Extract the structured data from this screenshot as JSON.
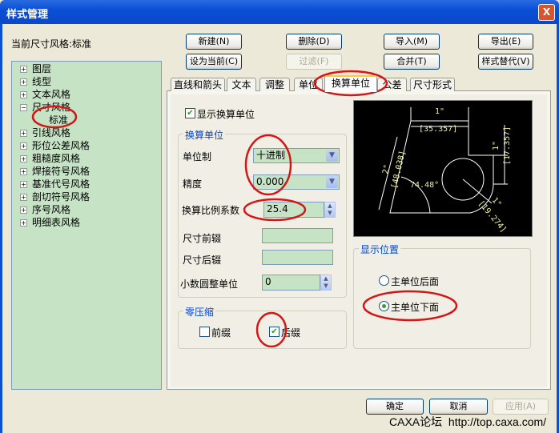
{
  "window": {
    "title": "样式管理",
    "close": "X"
  },
  "current_style": "当前尺寸风格:标准",
  "toolbar": {
    "new": "新建(N)",
    "delete": "删除(D)",
    "import": "导入(M)",
    "export": "导出(E)",
    "set_current": "设为当前(C)",
    "filter": "过滤(F)",
    "merge": "合并(T)",
    "replace": "样式替代(V)"
  },
  "tree": {
    "items": [
      {
        "label": "图层",
        "expanded": false
      },
      {
        "label": "线型",
        "expanded": false
      },
      {
        "label": "文本风格",
        "expanded": false
      },
      {
        "label": "尺寸风格",
        "expanded": true,
        "children": [
          "标准"
        ]
      },
      {
        "label": "引线风格",
        "expanded": false
      },
      {
        "label": "形位公差风格",
        "expanded": false
      },
      {
        "label": "粗糙度风格",
        "expanded": false
      },
      {
        "label": "焊接符号风格",
        "expanded": false
      },
      {
        "label": "基准代号风格",
        "expanded": false
      },
      {
        "label": "剖切符号风格",
        "expanded": false
      },
      {
        "label": "序号风格",
        "expanded": false
      },
      {
        "label": "明细表风格",
        "expanded": false
      }
    ]
  },
  "tabs": [
    "直线和箭头",
    "文本",
    "调整",
    "单位",
    "换算单位",
    "公差",
    "尺寸形式"
  ],
  "active_tab": "换算单位",
  "panel": {
    "show_alt_units": {
      "label": "显示换算单位",
      "checked": true
    },
    "alt_group": "换算单位",
    "unit_format": {
      "label": "单位制",
      "value": "十进制"
    },
    "precision": {
      "label": "精度",
      "value": "0.000"
    },
    "multiplier": {
      "label": "换算比例系数",
      "value": "25.4"
    },
    "prefix": {
      "label": "尺寸前辍",
      "value": ""
    },
    "suffix": {
      "label": "尺寸后辍",
      "value": ""
    },
    "round_off": {
      "label": "小数圆整单位",
      "value": "0"
    },
    "zero_group": "零压缩",
    "leading": {
      "label": "前缀",
      "checked": false
    },
    "trailing": {
      "label": "后缀",
      "checked": true
    },
    "placement_group": "显示位置",
    "after_primary": {
      "label": "主单位后面",
      "selected": false
    },
    "below_primary": {
      "label": "主单位下面",
      "selected": true
    }
  },
  "preview": {
    "top_dim": "1\"",
    "top_alt": "[35.357]",
    "right_dim": "1\"",
    "right_alt": "[17.357]",
    "left_dim": "2\"",
    "left_alt": "[48.038]",
    "angle": "74.48°",
    "radius_dim": "1\"",
    "radius_alt": "[19.274]"
  },
  "footer": {
    "ok": "确定",
    "cancel": "取消",
    "apply": "应用(A)"
  },
  "watermark": "CAXA论坛  http://top.caxa.com/",
  "colors": {
    "annotation": "#d01818",
    "field_bg": "#c6e3c6",
    "preview_text": "#f0f0a0"
  }
}
